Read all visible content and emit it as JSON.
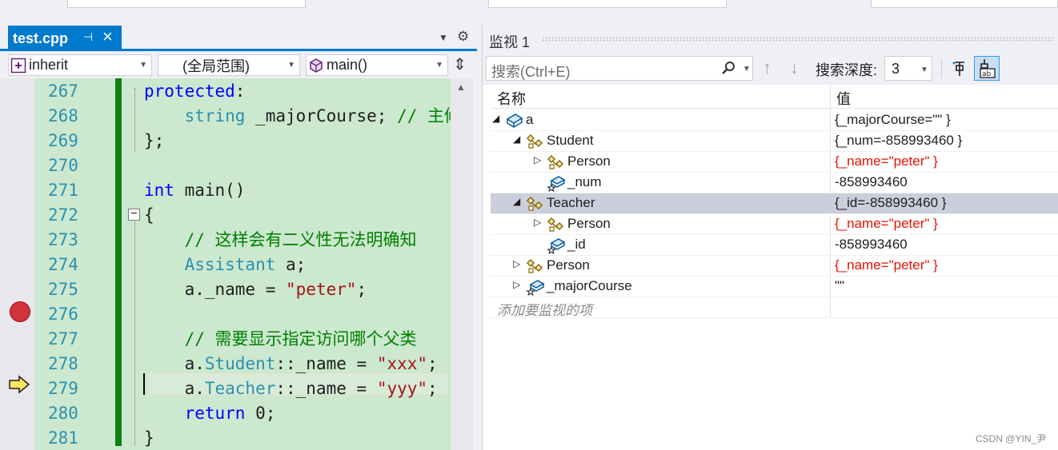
{
  "editor": {
    "tab": {
      "title": "test.cpp",
      "pin_icon": "pin-icon",
      "close_icon": "close-icon"
    },
    "nav": {
      "project": "inherit",
      "scope": "(全局范围)",
      "member": "main()"
    },
    "lines": [
      {
        "num": "267",
        "tokens": [
          [
            "kw",
            "protected"
          ],
          [
            "",
            ":"
          ]
        ]
      },
      {
        "num": "268",
        "tokens": [
          [
            "",
            "    "
          ],
          [
            "ty",
            "string"
          ],
          [
            "",
            " _majorCourse; "
          ],
          [
            "cm",
            "// 主修"
          ]
        ]
      },
      {
        "num": "269",
        "tokens": [
          [
            "",
            "};"
          ]
        ]
      },
      {
        "num": "270",
        "tokens": []
      },
      {
        "num": "271",
        "tokens": [
          [
            "kw",
            "int"
          ],
          [
            "",
            " main()"
          ]
        ]
      },
      {
        "num": "272",
        "tokens": [
          [
            "",
            "{"
          ]
        ]
      },
      {
        "num": "273",
        "tokens": [
          [
            "",
            "    "
          ],
          [
            "cm",
            "// 这样会有二义性无法明确知"
          ]
        ]
      },
      {
        "num": "274",
        "tokens": [
          [
            "",
            "    "
          ],
          [
            "ty",
            "Assistant"
          ],
          [
            "",
            " a;"
          ]
        ]
      },
      {
        "num": "275",
        "tokens": [
          [
            "",
            "    a._name = "
          ],
          [
            "st",
            "\"peter\""
          ],
          [
            "",
            ";"
          ]
        ]
      },
      {
        "num": "276",
        "tokens": []
      },
      {
        "num": "277",
        "tokens": [
          [
            "",
            "    "
          ],
          [
            "cm",
            "// 需要显示指定访问哪个父类"
          ]
        ]
      },
      {
        "num": "278",
        "tokens": [
          [
            "",
            "    a."
          ],
          [
            "ty",
            "Student"
          ],
          [
            "",
            "::_name = "
          ],
          [
            "st",
            "\"xxx\""
          ],
          [
            "",
            ";"
          ]
        ]
      },
      {
        "num": "279",
        "tokens": [
          [
            "",
            "    a."
          ],
          [
            "ty",
            "Teacher"
          ],
          [
            "",
            "::_name = "
          ],
          [
            "st",
            "\"yyy\""
          ],
          [
            "",
            ";"
          ]
        ]
      },
      {
        "num": "280",
        "tokens": [
          [
            "",
            "    "
          ],
          [
            "kw",
            "return"
          ],
          [
            "",
            " 0;"
          ]
        ]
      },
      {
        "num": "281",
        "tokens": [
          [
            "",
            "}"
          ]
        ]
      }
    ],
    "breakpoint_line": "275",
    "current_line": "278"
  },
  "watch": {
    "title": "监视 1",
    "search_placeholder": "搜索(Ctrl+E)",
    "depth_label": "搜索深度:",
    "depth_value": "3",
    "col_name": "名称",
    "col_value": "值",
    "rows": [
      {
        "level": 0,
        "expander": "open",
        "icon": "object-icon",
        "name": "a",
        "value": "{_majorCourse=\"\" }",
        "red": false,
        "selected": false
      },
      {
        "level": 1,
        "expander": "open",
        "icon": "base-class-icon",
        "name": "Student",
        "value": "{_num=-858993460 }",
        "red": false,
        "selected": false
      },
      {
        "level": 2,
        "expander": "closed",
        "icon": "base-class-icon",
        "name": "Person",
        "value": "{_name=\"peter\" }",
        "red": true,
        "selected": false
      },
      {
        "level": 2,
        "expander": "none",
        "icon": "field-icon",
        "name": "_num",
        "value": "-858993460",
        "red": false,
        "selected": false
      },
      {
        "level": 1,
        "expander": "open",
        "icon": "base-class-icon",
        "name": "Teacher",
        "value": "{_id=-858993460 }",
        "red": false,
        "selected": true
      },
      {
        "level": 2,
        "expander": "closed",
        "icon": "base-class-icon",
        "name": "Person",
        "value": "{_name=\"peter\" }",
        "red": true,
        "selected": false
      },
      {
        "level": 2,
        "expander": "none",
        "icon": "field-icon",
        "name": "_id",
        "value": "-858993460",
        "red": false,
        "selected": false
      },
      {
        "level": 1,
        "expander": "closed",
        "icon": "base-class-icon",
        "name": "Person",
        "value": "{_name=\"peter\" }",
        "red": true,
        "selected": false
      },
      {
        "level": 1,
        "expander": "closed",
        "icon": "field-icon",
        "name": "_majorCourse",
        "value": "\"\"",
        "red": false,
        "selected": false
      }
    ],
    "add_watch_placeholder": "添加要监视的项"
  },
  "watermark": "CSDN @YIN_尹",
  "colors": {
    "accent": "#007acc",
    "code_bg_changed": "#cce8cf",
    "keyword": "#0000ff",
    "type": "#2b91af",
    "comment": "#008000",
    "string": "#a31515",
    "changed_value": "#e51400",
    "breakpoint": "#d13438",
    "selection": "#cccedb"
  }
}
